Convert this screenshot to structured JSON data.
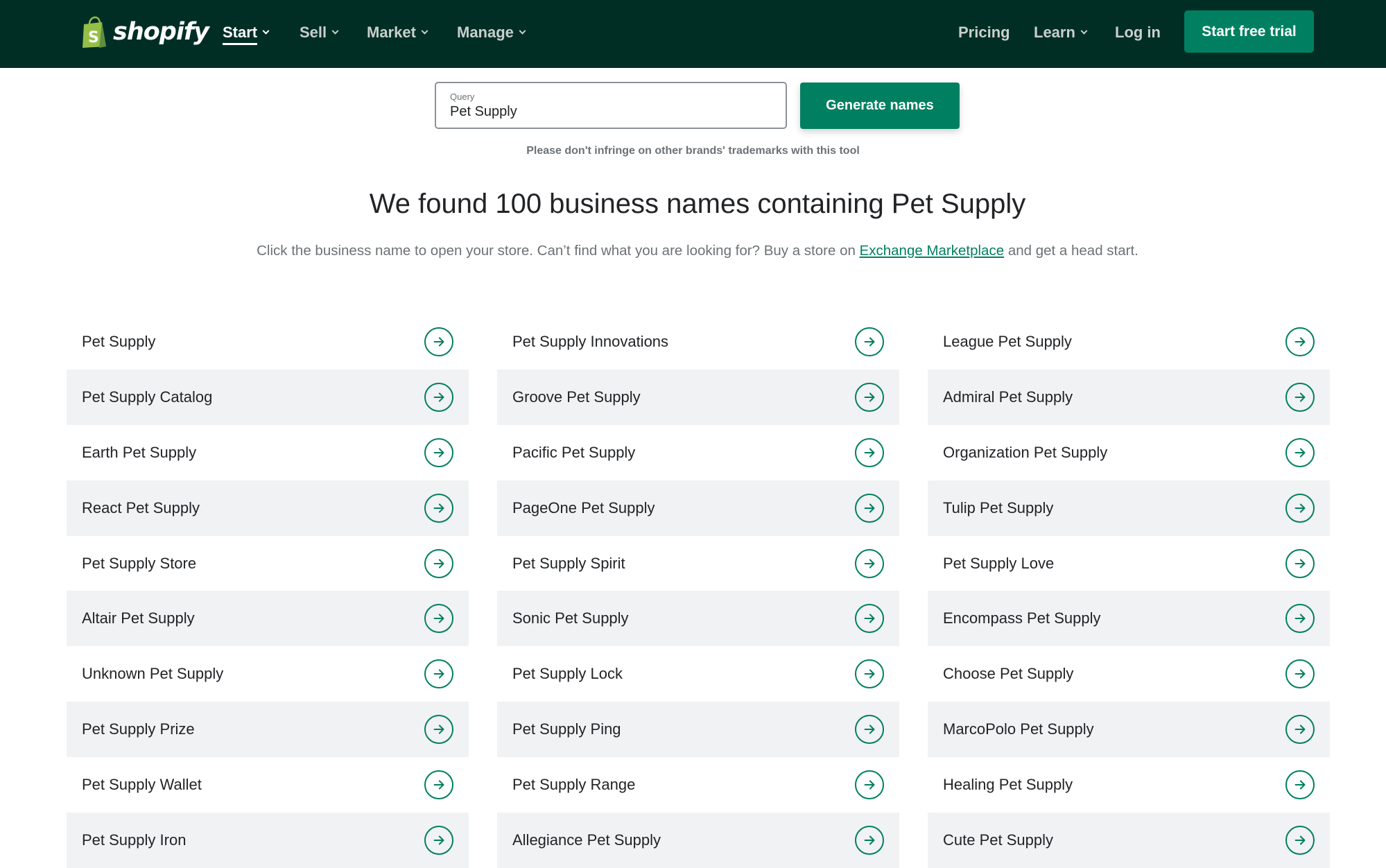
{
  "header": {
    "brand": "shopify",
    "nav": [
      {
        "label": "Start",
        "active": true
      },
      {
        "label": "Sell",
        "active": false
      },
      {
        "label": "Market",
        "active": false
      },
      {
        "label": "Manage",
        "active": false
      }
    ],
    "right_nav": {
      "pricing": "Pricing",
      "learn": "Learn",
      "login": "Log in",
      "cta": "Start free trial"
    },
    "colors": {
      "background": "#002e25",
      "cta": "#008060"
    }
  },
  "search": {
    "label": "Query",
    "value": "Pet Supply",
    "button": "Generate names",
    "disclaimer": "Please don't infringe on other brands' trademarks with this tool"
  },
  "results": {
    "heading": "We found 100 business names containing Pet Supply",
    "subtitle_before": "Click the business name to open your store. Can’t find what you are looking for? Buy a store on ",
    "subtitle_link": "Exchange Marketplace",
    "subtitle_after": " and get a head start.",
    "columns": [
      [
        "Pet Supply",
        "Pet Supply Catalog",
        "Earth Pet Supply",
        "React Pet Supply",
        "Pet Supply Store",
        "Altair Pet Supply",
        "Unknown Pet Supply",
        "Pet Supply Prize",
        "Pet Supply Wallet",
        "Pet Supply Iron"
      ],
      [
        "Pet Supply Innovations",
        "Groove Pet Supply",
        "Pacific Pet Supply",
        "PageOne Pet Supply",
        "Pet Supply Spirit",
        "Sonic Pet Supply",
        "Pet Supply Lock",
        "Pet Supply Ping",
        "Pet Supply Range",
        "Allegiance Pet Supply"
      ],
      [
        "League Pet Supply",
        "Admiral Pet Supply",
        "Organization Pet Supply",
        "Tulip Pet Supply",
        "Pet Supply Love",
        "Encompass Pet Supply",
        "Choose Pet Supply",
        "MarcoPolo Pet Supply",
        "Healing Pet Supply",
        "Cute Pet Supply"
      ]
    ],
    "row_icon": "arrow-right-circle-icon",
    "accent": "#008060"
  }
}
